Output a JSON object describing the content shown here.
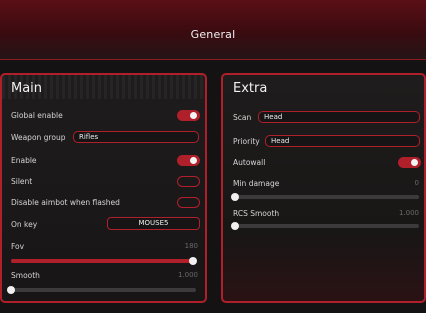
{
  "header": {
    "title": "General"
  },
  "main": {
    "title": "Main",
    "global_enable": {
      "label": "Global enable",
      "on": true
    },
    "weapon_group": {
      "label": "Weapon group",
      "value": "Rifles"
    },
    "enable": {
      "label": "Enable",
      "on": true
    },
    "silent": {
      "label": "Silent",
      "on": false
    },
    "disable_flashed": {
      "label": "Disable aimbot when flashed",
      "on": false
    },
    "on_key": {
      "label": "On key",
      "value": "MOUSE5"
    },
    "fov": {
      "label": "Fov",
      "value": "180",
      "fraction": 1.0
    },
    "smooth": {
      "label": "Smooth",
      "value": "1.000",
      "fraction": 0.0
    }
  },
  "extra": {
    "title": "Extra",
    "scan": {
      "label": "Scan",
      "value": "Head"
    },
    "priority": {
      "label": "Priority",
      "value": "Head"
    },
    "autowall": {
      "label": "Autowall",
      "on": true
    },
    "min_damage": {
      "label": "Min damage",
      "value": "0",
      "fraction": 0.0
    },
    "rcs_smooth": {
      "label": "RCS Smooth",
      "value": "1.000",
      "fraction": 0.0
    }
  },
  "colors": {
    "accent": "#b0202b",
    "background": "#141212",
    "header": "#4a0d13"
  }
}
